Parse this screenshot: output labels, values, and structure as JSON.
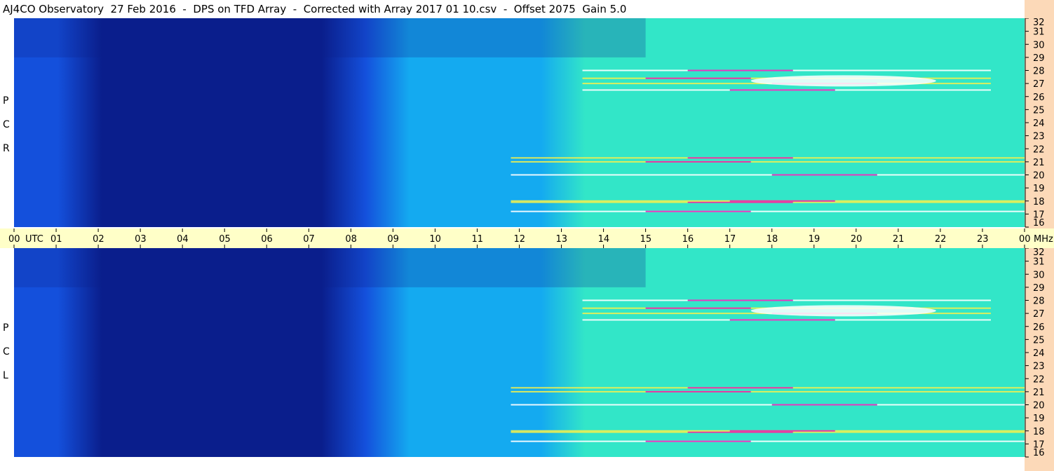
{
  "title": "AJ4CO Observatory  27 Feb 2016  -  DPS on TFD Array  -  Corrected with Array 2017 01 10.csv  -  Offset 2075  Gain 5.0",
  "panels": {
    "top_label_letters": [
      "R",
      "C",
      "P"
    ],
    "bottom_label_letters": [
      "L",
      "C",
      "P"
    ]
  },
  "colors": {
    "axis_bg": "#fcd9b8",
    "time_axis_bg": "#ffffc8",
    "spectrum_dark": "#0a1e8c",
    "spectrum_low": "#1450dc",
    "spectrum_mid": "#14aaf0",
    "spectrum_high": "#32e6c8",
    "spectrum_peak": "#f0f050",
    "spectrum_burst": "#e614b4"
  },
  "chart_data": {
    "type": "heatmap",
    "title": "AJ4CO Observatory  27 Feb 2016  -  DPS on TFD Array  -  Corrected with Array 2017 01 10.csv  -  Offset 2075  Gain 5.0",
    "xlabel": "UTC",
    "ylabel": "MHz",
    "x_ticks": [
      "00",
      "01",
      "02",
      "03",
      "04",
      "05",
      "06",
      "07",
      "08",
      "09",
      "10",
      "11",
      "12",
      "13",
      "14",
      "15",
      "16",
      "17",
      "18",
      "19",
      "20",
      "21",
      "22",
      "23",
      "00"
    ],
    "xlim": [
      0,
      24
    ],
    "y_ticks": [
      "16",
      "17",
      "18",
      "19",
      "20",
      "21",
      "22",
      "23",
      "24",
      "25",
      "26",
      "27",
      "28",
      "29",
      "30",
      "31",
      "32"
    ],
    "ylim": [
      16,
      32
    ],
    "series": [
      {
        "name": "RCP",
        "intensity_profile_by_hour": [
          0.35,
          0.3,
          0.22,
          0.12,
          0.08,
          0.06,
          0.1,
          0.22,
          0.4,
          0.52,
          0.6,
          0.68,
          0.72,
          0.78,
          0.84,
          0.88,
          0.9,
          0.92,
          0.95,
          0.97,
          0.96,
          0.93,
          0.9,
          0.85
        ]
      },
      {
        "name": "LCP",
        "intensity_profile_by_hour": [
          0.35,
          0.3,
          0.22,
          0.12,
          0.08,
          0.06,
          0.1,
          0.22,
          0.4,
          0.52,
          0.6,
          0.68,
          0.72,
          0.78,
          0.84,
          0.88,
          0.9,
          0.92,
          0.95,
          0.97,
          0.96,
          0.93,
          0.9,
          0.85
        ]
      }
    ],
    "strong_interference_mhz": [
      17.2,
      17.9,
      18.0,
      20.0,
      21.0,
      21.3,
      26.5,
      27.0,
      27.4,
      28.0
    ],
    "grid": false
  }
}
